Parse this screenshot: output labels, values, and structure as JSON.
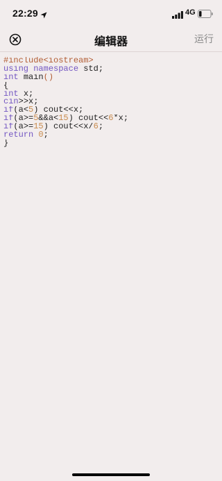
{
  "status_bar": {
    "time": "22:29",
    "network": "4G",
    "icons": [
      "location-arrow-icon",
      "signal-bars-icon",
      "battery-icon"
    ]
  },
  "nav": {
    "close_icon": "close-circle-icon",
    "title": "编辑器",
    "run_label": "运行"
  },
  "editor": {
    "lines": [
      "#include<iostream>",
      "using namespace std;",
      "int main()",
      "{",
      "int x;",
      "cin>>x;",
      "if(a<5) cout<<x;",
      "if(a>=5&&a<15) cout<<6*x;",
      "if(a>=15) cout<<x/6;",
      "return 0;",
      "}"
    ]
  },
  "colors": {
    "background": "#f2eded",
    "preprocessor": "#b25d34",
    "keyword": "#7356c2",
    "number": "#c88b4e",
    "run_label": "#8a8a8a"
  }
}
